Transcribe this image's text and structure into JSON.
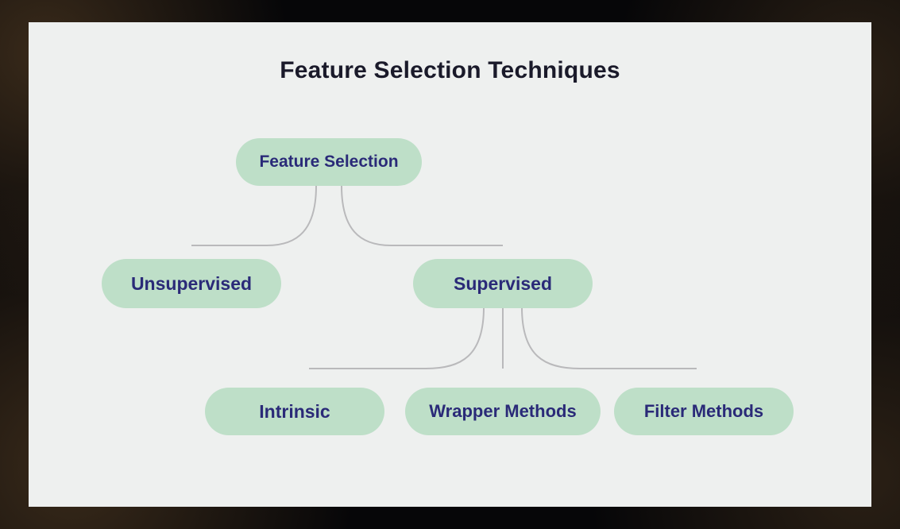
{
  "title": "Feature Selection Techniques",
  "nodes": {
    "root": {
      "label": "Feature Selection"
    },
    "unsupervised": {
      "label": "Unsupervised"
    },
    "supervised": {
      "label": "Supervised"
    },
    "intrinsic": {
      "label": "Intrinsic"
    },
    "wrapper": {
      "label": "Wrapper Methods"
    },
    "filter": {
      "label": "Filter Methods"
    }
  },
  "colors": {
    "node_bg": "#bedfc8",
    "node_text": "#2a2a78",
    "panel_bg": "#eef0ef",
    "connector": "#b9b9bb"
  }
}
